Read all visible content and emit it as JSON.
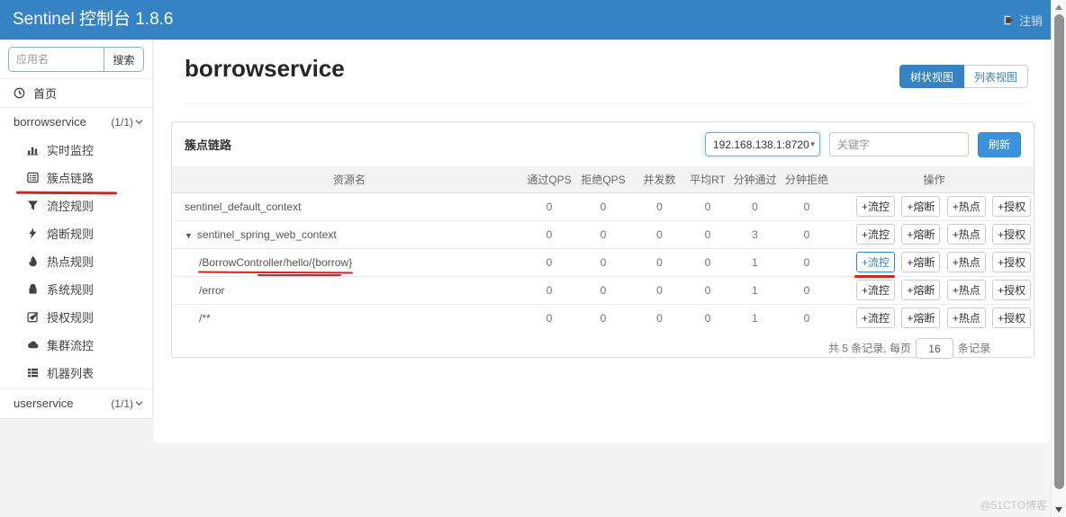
{
  "header": {
    "title": "Sentinel 控制台 1.8.6",
    "logout": "注销"
  },
  "sidebar": {
    "search_placeholder": "应用名",
    "search_button": "搜索",
    "home_label": "首页",
    "groups": [
      {
        "name": "borrowservice",
        "count": "(1/1)"
      },
      {
        "name": "userservice",
        "count": "(1/1)"
      }
    ],
    "items": [
      {
        "label": "实时监控",
        "icon": "bar-chart-icon"
      },
      {
        "label": "簇点链路",
        "icon": "list-alt-icon"
      },
      {
        "label": "流控规则",
        "icon": "filter-icon"
      },
      {
        "label": "熔断规则",
        "icon": "bolt-icon"
      },
      {
        "label": "热点规则",
        "icon": "fire-icon"
      },
      {
        "label": "系统规则",
        "icon": "lock-icon"
      },
      {
        "label": "授权规则",
        "icon": "check-square-icon"
      },
      {
        "label": "集群流控",
        "icon": "cloud-icon"
      },
      {
        "label": "机器列表",
        "icon": "machine-list-icon"
      }
    ]
  },
  "main": {
    "page_title": "borrowservice",
    "view_tree": "树状视图",
    "view_list": "列表视图"
  },
  "panel": {
    "title": "簇点链路",
    "machine": "192.168.138.1:8720",
    "keyword_placeholder": "关键字",
    "refresh": "刷新"
  },
  "table": {
    "columns": [
      "资源名",
      "通过QPS",
      "拒绝QPS",
      "并发数",
      "平均RT",
      "分钟通过",
      "分钟拒绝",
      "操作"
    ],
    "action_labels": [
      "+流控",
      "+熔断",
      "+热点",
      "+授权"
    ],
    "rows": [
      {
        "resource": "sentinel_default_context",
        "values": [
          "0",
          "0",
          "0",
          "0",
          "0",
          "0"
        ]
      },
      {
        "resource": "sentinel_spring_web_context",
        "values": [
          "0",
          "0",
          "0",
          "0",
          "3",
          "0"
        ]
      },
      {
        "resource": "/BorrowController/hello/{borrow}",
        "values": [
          "0",
          "0",
          "0",
          "0",
          "1",
          "0"
        ]
      },
      {
        "resource": "/error",
        "values": [
          "0",
          "0",
          "0",
          "0",
          "1",
          "0"
        ]
      },
      {
        "resource": "/**",
        "values": [
          "0",
          "0",
          "0",
          "0",
          "1",
          "0"
        ]
      }
    ],
    "pager": {
      "prefix": "共 5 条记录, 每页",
      "size": "16",
      "suffix": "条记录"
    }
  },
  "watermark": "@51CTO博客",
  "colors": {
    "accent": "#3583c5",
    "refresh_button": "#3992db",
    "annotation_red": "#df1f1a"
  }
}
